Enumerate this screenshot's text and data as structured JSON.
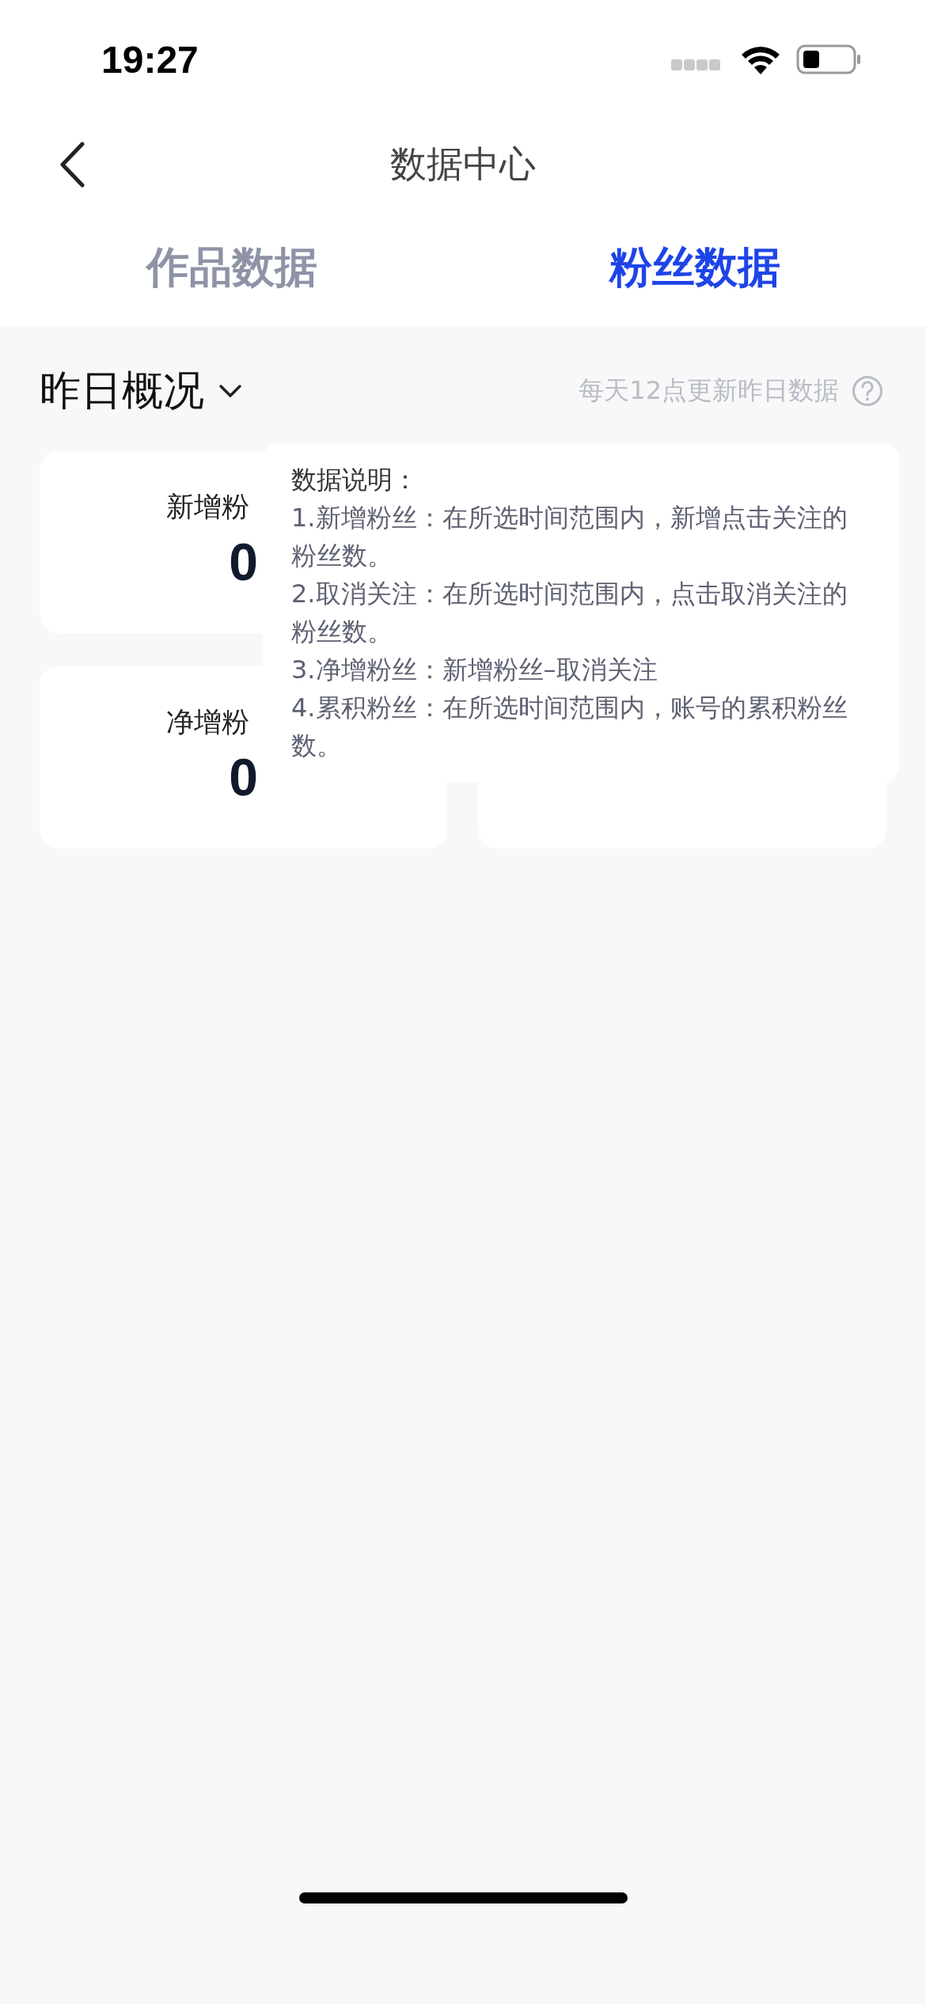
{
  "status_bar": {
    "time": "19:27"
  },
  "nav": {
    "title": "数据中心"
  },
  "tabs": [
    {
      "label": "作品数据",
      "selected": false
    },
    {
      "label": "粉丝数据",
      "selected": true
    }
  ],
  "overview": {
    "title": "昨日概况",
    "hint": "每天12点更新昨日数据"
  },
  "card_rows": [
    {
      "cards": [
        {
          "kind": "stat",
          "label": "新增粉",
          "value": "0"
        }
      ]
    },
    {
      "cards": [
        {
          "kind": "stat",
          "label": "净增粉",
          "value": "0"
        },
        {
          "kind": "covered"
        }
      ]
    }
  ],
  "tooltip": {
    "title": "数据说明：",
    "lines": [
      "1.新增粉丝：在所选时间范围内，新增点击关注的粉丝数。",
      "2.取消关注：在所选时间范围内，点击取消关注的粉丝数。",
      "3.净增粉丝：新增粉丝–取消关注",
      "4.累积粉丝：在所选时间范围内，账号的累积粉丝数。"
    ]
  }
}
